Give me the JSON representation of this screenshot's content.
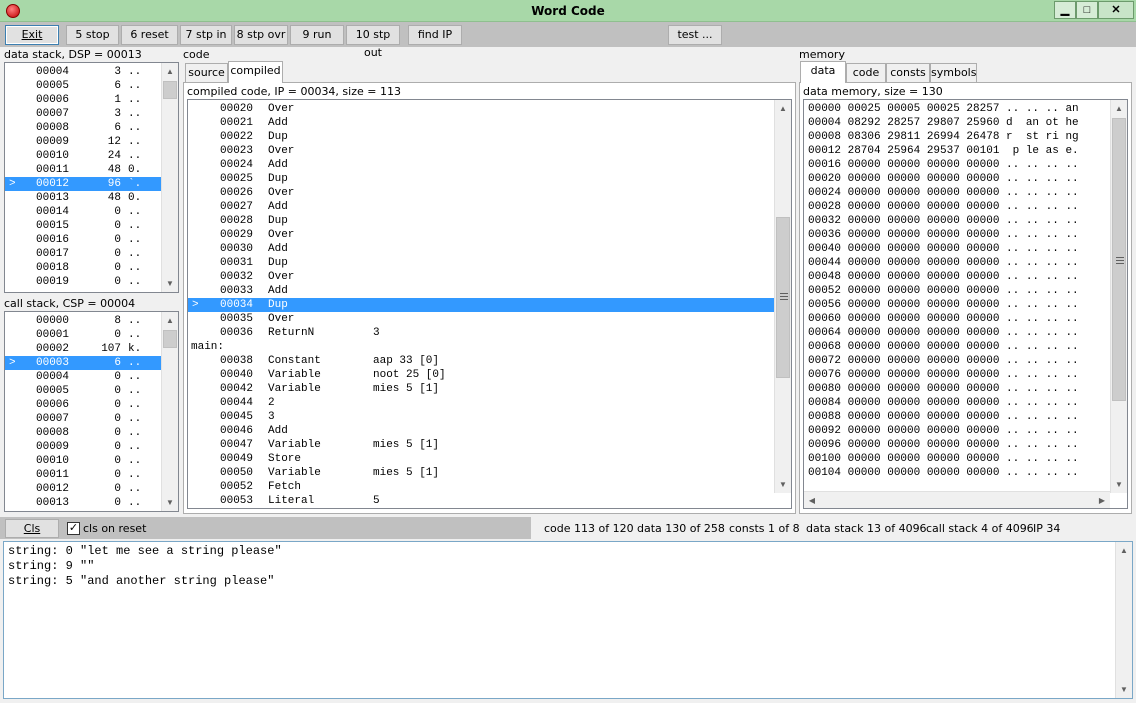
{
  "window": {
    "title": "Word Code",
    "minimize": "▁",
    "maximize": "□",
    "close": "✕",
    "app_icon": "app-icon"
  },
  "toolbar": {
    "exit": "Exit",
    "stop": "5 stop",
    "reset": "6 reset",
    "step_in": "7 stp in",
    "step_over": "8 stp ovr",
    "run": "9 run",
    "step_out": "10 stp out",
    "find_ip": "find IP",
    "test": "test ..."
  },
  "data_stack": {
    "label": "data stack, DSP = 00013",
    "rows": [
      {
        "addr": "00004",
        "val": "3",
        "chr": ".."
      },
      {
        "addr": "00005",
        "val": "6",
        "chr": ".."
      },
      {
        "addr": "00006",
        "val": "1",
        "chr": ".."
      },
      {
        "addr": "00007",
        "val": "3",
        "chr": ".."
      },
      {
        "addr": "00008",
        "val": "6",
        "chr": ".."
      },
      {
        "addr": "00009",
        "val": "12",
        "chr": ".."
      },
      {
        "addr": "00010",
        "val": "24",
        "chr": ".."
      },
      {
        "addr": "00011",
        "val": "48",
        "chr": "0."
      },
      {
        "addr": "00012",
        "val": "96",
        "chr": "`.",
        "selected": true
      },
      {
        "addr": "00013",
        "val": "48",
        "chr": "0."
      },
      {
        "addr": "00014",
        "val": "0",
        "chr": ".."
      },
      {
        "addr": "00015",
        "val": "0",
        "chr": ".."
      },
      {
        "addr": "00016",
        "val": "0",
        "chr": ".."
      },
      {
        "addr": "00017",
        "val": "0",
        "chr": ".."
      },
      {
        "addr": "00018",
        "val": "0",
        "chr": ".."
      },
      {
        "addr": "00019",
        "val": "0",
        "chr": ".."
      }
    ]
  },
  "call_stack": {
    "label": "call stack, CSP = 00004",
    "rows": [
      {
        "addr": "00000",
        "val": "8",
        "chr": ".."
      },
      {
        "addr": "00001",
        "val": "0",
        "chr": ".."
      },
      {
        "addr": "00002",
        "val": "107",
        "chr": "k."
      },
      {
        "addr": "00003",
        "val": "6",
        "chr": "..",
        "selected": true
      },
      {
        "addr": "00004",
        "val": "0",
        "chr": ".."
      },
      {
        "addr": "00005",
        "val": "0",
        "chr": ".."
      },
      {
        "addr": "00006",
        "val": "0",
        "chr": ".."
      },
      {
        "addr": "00007",
        "val": "0",
        "chr": ".."
      },
      {
        "addr": "00008",
        "val": "0",
        "chr": ".."
      },
      {
        "addr": "00009",
        "val": "0",
        "chr": ".."
      },
      {
        "addr": "00010",
        "val": "0",
        "chr": ".."
      },
      {
        "addr": "00011",
        "val": "0",
        "chr": ".."
      },
      {
        "addr": "00012",
        "val": "0",
        "chr": ".."
      },
      {
        "addr": "00013",
        "val": "0",
        "chr": ".."
      }
    ]
  },
  "code": {
    "label": "code",
    "tabs": [
      "source",
      "compiled"
    ],
    "active_tab": "compiled",
    "header": "compiled code, IP = 00034, size = 113",
    "marker": ">",
    "rows": [
      {
        "addr": "00020",
        "op": "Over",
        "arg": ""
      },
      {
        "addr": "00021",
        "op": "Add",
        "arg": ""
      },
      {
        "addr": "00022",
        "op": "Dup",
        "arg": ""
      },
      {
        "addr": "00023",
        "op": "Over",
        "arg": ""
      },
      {
        "addr": "00024",
        "op": "Add",
        "arg": ""
      },
      {
        "addr": "00025",
        "op": "Dup",
        "arg": ""
      },
      {
        "addr": "00026",
        "op": "Over",
        "arg": ""
      },
      {
        "addr": "00027",
        "op": "Add",
        "arg": ""
      },
      {
        "addr": "00028",
        "op": "Dup",
        "arg": ""
      },
      {
        "addr": "00029",
        "op": "Over",
        "arg": ""
      },
      {
        "addr": "00030",
        "op": "Add",
        "arg": ""
      },
      {
        "addr": "00031",
        "op": "Dup",
        "arg": ""
      },
      {
        "addr": "00032",
        "op": "Over",
        "arg": ""
      },
      {
        "addr": "00033",
        "op": "Add",
        "arg": ""
      },
      {
        "addr": "00034",
        "op": "Dup",
        "arg": "",
        "selected": true
      },
      {
        "addr": "00035",
        "op": "Over",
        "arg": ""
      },
      {
        "addr": "00036",
        "op": "ReturnN",
        "arg": "3"
      },
      {
        "label": "main:"
      },
      {
        "addr": "00038",
        "op": "Constant",
        "arg": "aap 33 [0]"
      },
      {
        "addr": "00040",
        "op": "Variable",
        "arg": "noot 25 [0]"
      },
      {
        "addr": "00042",
        "op": "Variable",
        "arg": "mies 5 [1]"
      },
      {
        "addr": "00044",
        "op": "2",
        "arg": ""
      },
      {
        "addr": "00045",
        "op": "3",
        "arg": ""
      },
      {
        "addr": "00046",
        "op": "Add",
        "arg": ""
      },
      {
        "addr": "00047",
        "op": "Variable",
        "arg": "mies 5 [1]"
      },
      {
        "addr": "00049",
        "op": "Store",
        "arg": ""
      },
      {
        "addr": "00050",
        "op": "Variable",
        "arg": "mies 5 [1]"
      },
      {
        "addr": "00052",
        "op": "Fetch",
        "arg": ""
      },
      {
        "addr": "00053",
        "op": "Literal",
        "arg": "5"
      }
    ]
  },
  "memory": {
    "label": "memory",
    "tabs": [
      "data",
      "code",
      "consts",
      "symbols"
    ],
    "active_tab": "data",
    "header": "data memory, size = 130",
    "rows": [
      "00000 00025 00005 00025 28257 .. .. .. an",
      "00004 08292 28257 29807 25960 d  an ot he",
      "00008 08306 29811 26994 26478 r  st ri ng",
      "00012 28704 25964 29537 00101  p le as e.",
      "00016 00000 00000 00000 00000 .. .. .. ..",
      "00020 00000 00000 00000 00000 .. .. .. ..",
      "00024 00000 00000 00000 00000 .. .. .. ..",
      "00028 00000 00000 00000 00000 .. .. .. ..",
      "00032 00000 00000 00000 00000 .. .. .. ..",
      "00036 00000 00000 00000 00000 .. .. .. ..",
      "00040 00000 00000 00000 00000 .. .. .. ..",
      "00044 00000 00000 00000 00000 .. .. .. ..",
      "00048 00000 00000 00000 00000 .. .. .. ..",
      "00052 00000 00000 00000 00000 .. .. .. ..",
      "00056 00000 00000 00000 00000 .. .. .. ..",
      "00060 00000 00000 00000 00000 .. .. .. ..",
      "00064 00000 00000 00000 00000 .. .. .. ..",
      "00068 00000 00000 00000 00000 .. .. .. ..",
      "00072 00000 00000 00000 00000 .. .. .. ..",
      "00076 00000 00000 00000 00000 .. .. .. ..",
      "00080 00000 00000 00000 00000 .. .. .. ..",
      "00084 00000 00000 00000 00000 .. .. .. ..",
      "00088 00000 00000 00000 00000 .. .. .. ..",
      "00092 00000 00000 00000 00000 .. .. .. ..",
      "00096 00000 00000 00000 00000 .. .. .. ..",
      "00100 00000 00000 00000 00000 .. .. .. ..",
      "00104 00000 00000 00000 00000 .. .. .. .."
    ]
  },
  "status": {
    "cls": "Cls",
    "cls_on_reset": "cls on reset",
    "cls_on_reset_checked": "✓",
    "code": "code 113 of 120",
    "data": "data 130 of 258",
    "consts": "consts 1 of 8",
    "data_stack": "data stack 13 of 4096",
    "call_stack": "call stack 4 of 4096",
    "ip": "IP 34"
  },
  "console": {
    "lines": [
      "string: 0 \"let me see a string please\"",
      "string: 9 \"\"",
      "string: 5 \"and another string please\""
    ]
  },
  "icons": {
    "scroll_up": "▲",
    "scroll_down": "▼",
    "scroll_left": "◀",
    "scroll_right": "▶"
  },
  "colors": {
    "titlebar": "#a8d8a8",
    "selection": "#3399ff",
    "toolbar_bg": "#c0c0c0"
  }
}
